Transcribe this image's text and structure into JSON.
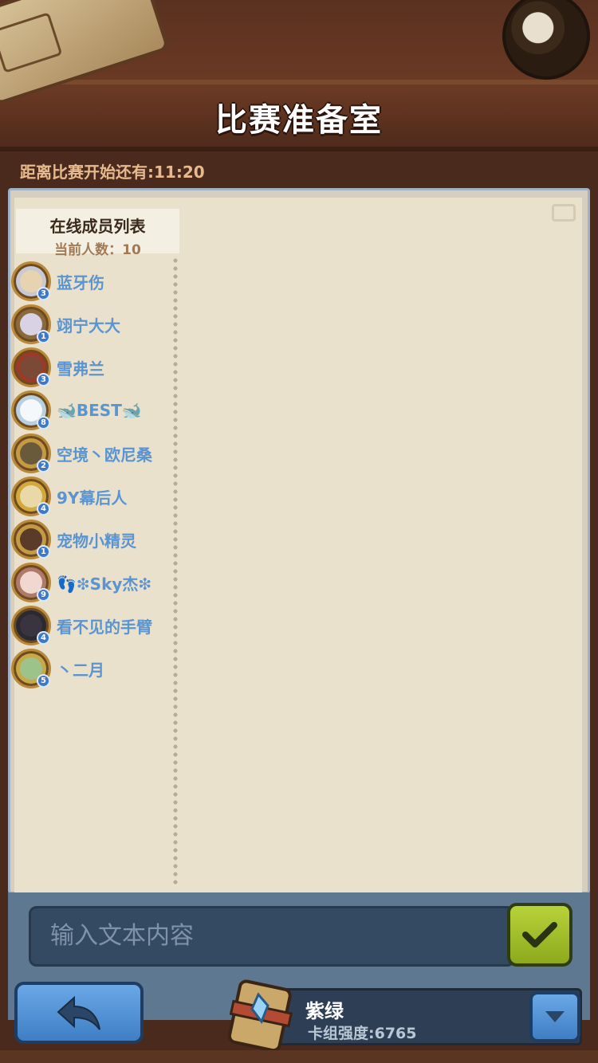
{
  "header": {
    "title": "比赛准备室"
  },
  "countdown": {
    "label": "距离比赛开始还有:11:20"
  },
  "member_list": {
    "title": "在线成员列表",
    "count_label": "当前人数：10",
    "members": [
      {
        "name": "蓝牙伤",
        "level": "3",
        "frame": "#c9c9d6",
        "face": "#e8d3b0"
      },
      {
        "name": "翊宁大大",
        "level": "1",
        "frame": "#8a6a3a",
        "face": "#d8d2e4"
      },
      {
        "name": "雪弗兰",
        "level": "3",
        "frame": "#9c3a2a",
        "face": "#7a4a36"
      },
      {
        "name": "🐋BEST🐋",
        "level": "8",
        "frame": "#b8cfe0",
        "face": "#f4f8fb"
      },
      {
        "name": "空境丶欧尼桑",
        "level": "2",
        "frame": "#c59a44",
        "face": "#6a5a3c"
      },
      {
        "name": "9Y幕后人",
        "level": "4",
        "frame": "#d4a93c",
        "face": "#e9d8a8"
      },
      {
        "name": "宠物小精灵",
        "level": "1",
        "frame": "#c59a44",
        "face": "#5a3a28"
      },
      {
        "name": "👣❇Sky杰❇",
        "level": "9",
        "frame": "#b07a6a",
        "face": "#f0d8d0"
      },
      {
        "name": "看不见的手臂",
        "level": "4",
        "frame": "#2a2a32",
        "face": "#3a3440"
      },
      {
        "name": "丶二月",
        "level": "5",
        "frame": "#c9a84a",
        "face": "#9cc48a"
      }
    ]
  },
  "chat": {
    "placeholder": "输入文本内容"
  },
  "deck": {
    "name": "紫绿",
    "power_label": "卡组强度:6765"
  },
  "colors": {
    "accent_green": "#a4c22c",
    "accent_blue": "#4f8fd6",
    "member_name": "#5a95d2"
  }
}
